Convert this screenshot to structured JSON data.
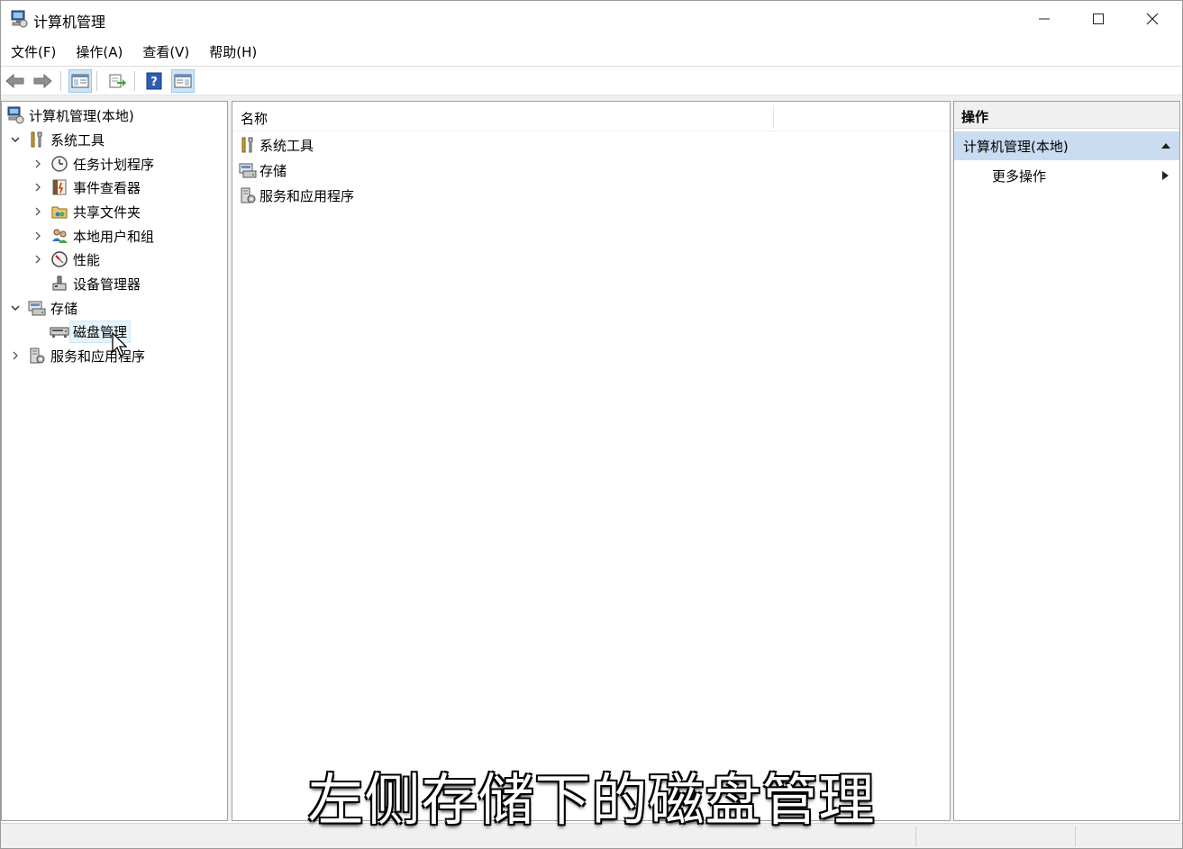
{
  "window": {
    "title": "计算机管理"
  },
  "menu": {
    "items": [
      "文件(F)",
      "操作(A)",
      "查看(V)",
      "帮助(H)"
    ]
  },
  "toolbar": {
    "buttons": [
      "back-icon",
      "forward-icon",
      "show-tree-icon",
      "export-list-icon",
      "help-icon",
      "show-action-pane-icon"
    ]
  },
  "tree": {
    "root": "计算机管理(本地)",
    "system_tools": "系统工具",
    "task_scheduler": "任务计划程序",
    "event_viewer": "事件查看器",
    "shared_folders": "共享文件夹",
    "local_users": "本地用户和组",
    "performance": "性能",
    "device_manager": "设备管理器",
    "storage": "存储",
    "disk_management": "磁盘管理",
    "services_apps": "服务和应用程序"
  },
  "list": {
    "column_name": "名称",
    "rows": [
      "系统工具",
      "存储",
      "服务和应用程序"
    ]
  },
  "actions": {
    "header": "操作",
    "section": "计算机管理(本地)",
    "more": "更多操作"
  },
  "caption": "左侧存储下的磁盘管理",
  "colors": {
    "selection": "#cce4f7",
    "action_section": "#c9dcf0",
    "pane_border": "#a0a0a0"
  }
}
